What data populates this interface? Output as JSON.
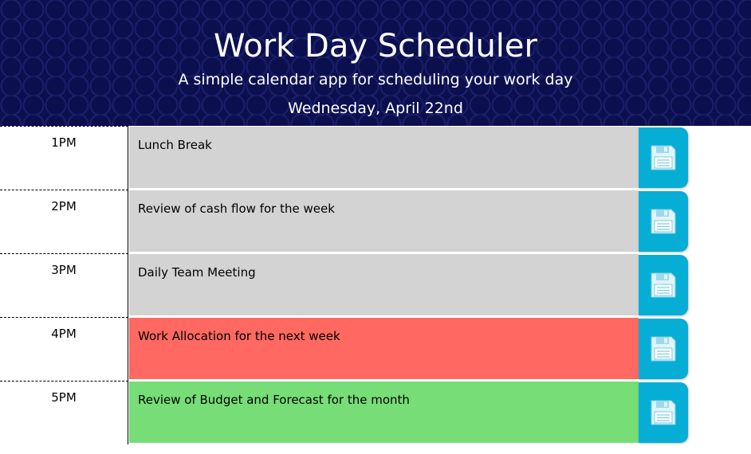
{
  "header": {
    "title": "Work Day Scheduler",
    "subtitle": "A simple calendar app for scheduling your work day",
    "current_day": "Wednesday, April 22nd"
  },
  "colors": {
    "header_bg": "#0c0f4e",
    "past": "#d3d3d3",
    "present": "#ff6961",
    "future": "#77dd77",
    "save_button": "#06aed5"
  },
  "time_blocks": [
    {
      "hour": "1PM",
      "text": "Lunch Break",
      "state": "past",
      "save_icon": "floppy-disk-icon"
    },
    {
      "hour": "2PM",
      "text": "Review of cash flow for the week",
      "state": "past",
      "save_icon": "floppy-disk-icon"
    },
    {
      "hour": "3PM",
      "text": "Daily Team Meeting",
      "state": "past",
      "save_icon": "floppy-disk-icon"
    },
    {
      "hour": "4PM",
      "text": "Work Allocation for the next week",
      "state": "present",
      "save_icon": "floppy-disk-icon"
    },
    {
      "hour": "5PM",
      "text": "Review of Budget and Forecast for the month",
      "state": "future",
      "save_icon": "floppy-disk-icon"
    }
  ]
}
